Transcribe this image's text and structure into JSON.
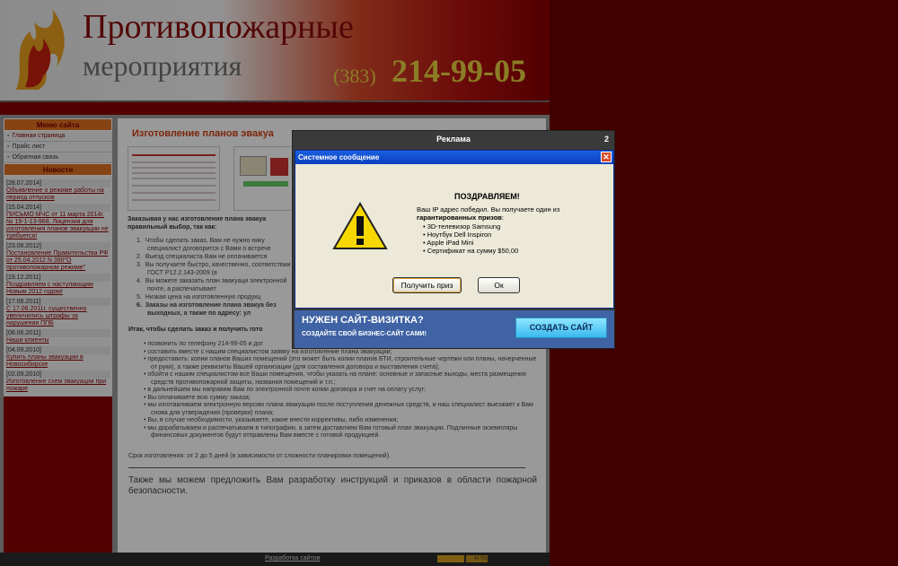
{
  "header": {
    "title": "Противопожарные",
    "subtitle": "мероприятия",
    "phone_code": "(383)",
    "phone_number": "214-99-05"
  },
  "sidebar": {
    "menu_title": "Меню сайта",
    "menu_items": [
      {
        "label": "Главная страница"
      },
      {
        "label": "Прайс лист"
      },
      {
        "label": "Обратная связь"
      }
    ],
    "news_title": "Новости",
    "news": [
      {
        "date": "[28.07.2014]",
        "text": "Объявление о режиме работы на период отпусков"
      },
      {
        "date": "[15.04.2014]",
        "text": "ПИСЬМО МЧС от 11 марта 2014г. № 19-1-13-968, Лицензия для изготовления планов эвакуации не требуется!"
      },
      {
        "date": "[23.06.2012]",
        "text": "Постановление Правительства РФ от 25.04.2012 N 390\"О противопожарном режиме\""
      },
      {
        "date": "[19.12.2011]",
        "text": "Поздравляем с наступающим Новым 2012 годом!"
      },
      {
        "date": "[17.06.2011]",
        "text": "С 17.06.2011г. существенно увеличились штрафы за нарушения ППБ"
      },
      {
        "date": "[08.06.2011]",
        "text": "Наши клиенты"
      },
      {
        "date": "[04.09.2010]",
        "text": "Купить планы эвакуации в Новосибирске"
      },
      {
        "date": "[02.09.2010]",
        "text": "Изготовление схем эвакуации при пожаре"
      }
    ]
  },
  "content": {
    "title": "Изготовление планов эвакуа",
    "intro": "Заказывая у нас изготовление плана эвакуа правильный выбор, так как:",
    "list": [
      "Чтобы сделать заказ, Вам не нужно нику специалист договорится с Вами о встрече",
      "Выезд специалиста Вам не оплачивается",
      "Вы получаете быстро, качественно, соответствии с ГОСТ Р12.2.143-2009 (в",
      "Вы можете заказать план эвакуаци электронной почте, а распечатывает",
      "Низкая цена на изготовленную продукц",
      "Заказы на изготовление плана эвакуа без выходных, а также по адресу: ул"
    ],
    "how_title": "Итак, чтобы сделать заказ и получить гото",
    "bullets": [
      "позвонить по телефону 214-99-05 и дог",
      "составить вместе с нашим специалистом заявку на изготовление плана эвакуации;",
      "предоставить: копии планов Ваших помещений (это может быть копии планов БТИ, строительные чертежи или планы, начерченные от руки), а также реквизиты Вашей организации (для составления договора и выставления счета);",
      "обойти с нашим специалистом все Ваши помещения, чтобы указать на плане: основные и запасные выходы, места размещения средств противопожарной защиты, названия помещений и т.п.;",
      "в дальнейшем мы направим Вам по электронной почте копии договора и счет на оплату услуг;",
      "Вы оплачиваете всю сумму заказа;",
      "мы изготавливаем электронную версию плана эвакуации после поступления денежных средств, и наш специалист выезжает к Вам снова для утверждения (проверки) плана;",
      "Вы, в случае необходимости, указываете, какие внести коррективы, либо изменения;",
      "мы дорабатываем и распечатываем в типографии, а затем доставляем Вам готовый план эвакуации. Подлинные экземпляры финансовых документов будут отправлены Вам вместе с готовой продукцией."
    ],
    "term": "Срок изготовления: от 2 до 5 дней (в зависимости от сложности планировки помещений).",
    "also": "Также мы можем предложить Вам разработку инструкций и приказов в области пожарной безопасности."
  },
  "footer": {
    "link": "Разработка сайтов",
    "counter1": "...",
    "counter2": "42 751"
  },
  "ad": {
    "title": "Реклама",
    "count": "2",
    "dialog_title": "Системное сообщение",
    "close": "✕",
    "congrats": "ПОЗДРАВЛЯЕМ!",
    "msg1": "Ваш IP адрес победил. Вы получаете один из ",
    "msg_bold": "гарантированных призов",
    "msg2": ":",
    "prizes": [
      "• 3D-телевизор Samsung",
      "• Ноутбук Dell Inspiron",
      "• Apple iPad Mini",
      "• Сертификат на сумму $50,00"
    ],
    "get_prize": "Получить приз",
    "ok": "Ок",
    "promo_heading": "НУЖЕН САЙТ-ВИЗИТКА?",
    "promo_sub": "СОЗДАЙТЕ СВОЙ БИЗНЕС-САЙТ САМИ!",
    "create_button": "СОЗДАТЬ САЙТ"
  }
}
